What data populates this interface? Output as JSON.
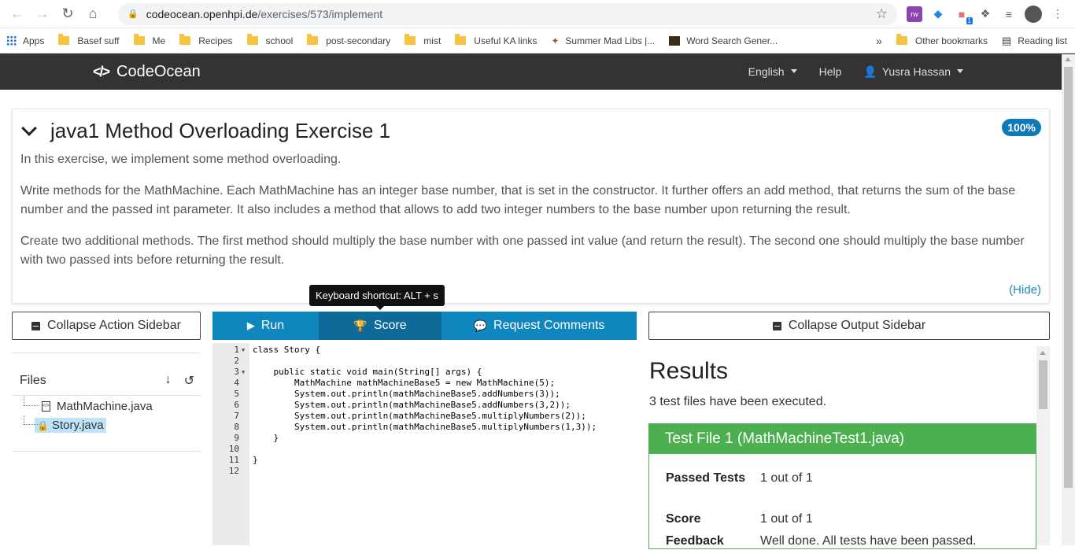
{
  "browser": {
    "url_host": "codeocean.openhpi.de",
    "url_path": "/exercises/573/implement",
    "bookmarks": [
      "Apps",
      "Basef suff",
      "Me",
      "Recipes",
      "school",
      "post-secondary",
      "mist",
      "Useful KA links",
      "Summer Mad Libs |...",
      "Word Search Gener..."
    ],
    "other_bookmarks": "Other bookmarks",
    "reading_list": "Reading list",
    "more": "»",
    "ext_badge": "1"
  },
  "navbar": {
    "brand": "CodeOcean",
    "language": "English",
    "help": "Help",
    "user": "Yusra Hassan"
  },
  "exercise": {
    "title": "java1 Method Overloading Exercise 1",
    "score_badge": "100%",
    "paragraphs": [
      "In this exercise, we implement some method overloading.",
      "Write methods for the MathMachine. Each MathMachine has an integer base number, that is set in the constructor. It further offers an add method, that returns the sum of the base number and the passed int parameter. It also includes a method that allows to add two integer numbers to the base number upon returning the result.",
      "Create two additional methods. The first method should multiply the base number with one passed int value (and return the result). The second one should multiply the base number with two passed ints before returning the result."
    ],
    "hide": "(Hide)"
  },
  "tooltip": "Keyboard shortcut: ALT + s",
  "sidebar": {
    "collapse_action": "Collapse Action Sidebar",
    "files_label": "Files",
    "files": [
      "MathMachine.java",
      "Story.java"
    ]
  },
  "toolbar": {
    "run": "Run",
    "score": "Score",
    "request_comments": "Request Comments"
  },
  "editor": {
    "lines": [
      "class Story {",
      "",
      "    public static void main(String[] args) {",
      "        MathMachine mathMachineBase5 = new MathMachine(5);",
      "        System.out.println(mathMachineBase5.addNumbers(3));",
      "        System.out.println(mathMachineBase5.addNumbers(3,2));",
      "        System.out.println(mathMachineBase5.multiplyNumbers(2));",
      "        System.out.println(mathMachineBase5.multiplyNumbers(1,3));",
      "    }",
      "",
      "}",
      ""
    ]
  },
  "output": {
    "collapse_output": "Collapse Output Sidebar",
    "results_title": "Results",
    "results_summary": "3 test files have been executed.",
    "test_file_title": "Test File 1 (MathMachineTest1.java)",
    "passed_label": "Passed Tests",
    "passed_value": "1 out of 1",
    "score_label": "Score",
    "score_value": "1 out of 1",
    "feedback_label": "Feedback",
    "feedback_value": "Well done. All tests have been passed."
  }
}
